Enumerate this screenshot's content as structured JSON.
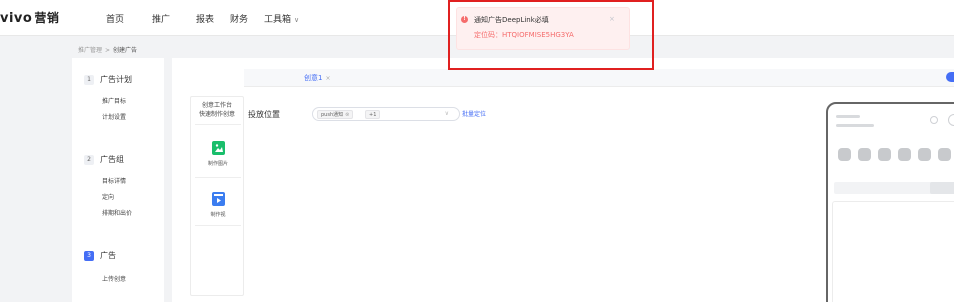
{
  "brand": {
    "logo": "vivo",
    "sub": "营销"
  },
  "nav": {
    "items": [
      "首页",
      "推广",
      "报表",
      "财务",
      "工具箱"
    ],
    "tools_caret": "∨"
  },
  "breadcrumb": {
    "parent": "推广管理",
    "separator": ">",
    "current": "创建广告"
  },
  "steps": [
    {
      "num": "1",
      "title": "广告计划",
      "subs": [
        "推广目标",
        "计划设置"
      ]
    },
    {
      "num": "2",
      "title": "广告组",
      "subs": [
        "目标详情",
        "定向",
        "排期和出价"
      ]
    },
    {
      "num": "3",
      "title": "广告",
      "subs": [
        "上传创意"
      ]
    }
  ],
  "tools": {
    "header_line1": "创意工作台",
    "header_line2": "快速制作创意",
    "items": [
      {
        "label": "制作图片",
        "icon": "image-icon",
        "color": "#19be6b"
      },
      {
        "label": "制作视",
        "icon": "video-icon",
        "color": "#3b7df0"
      }
    ]
  },
  "tab": {
    "label": "创意1",
    "close": "×"
  },
  "form": {
    "placement_label": "投放位置",
    "tags": [
      {
        "text": "push通知",
        "close": "⊗"
      },
      {
        "text": "+1",
        "close": ""
      }
    ],
    "select_caret": "∨",
    "batch_link": "批量定位"
  },
  "toast": {
    "message": "通知广告DeepLink必填",
    "code": "定位码：HTQIOFMISE5HG3YA",
    "close": "×"
  },
  "colors": {
    "accent": "#456ef5",
    "error": "#f56c6c",
    "highlight": "#e02020"
  }
}
